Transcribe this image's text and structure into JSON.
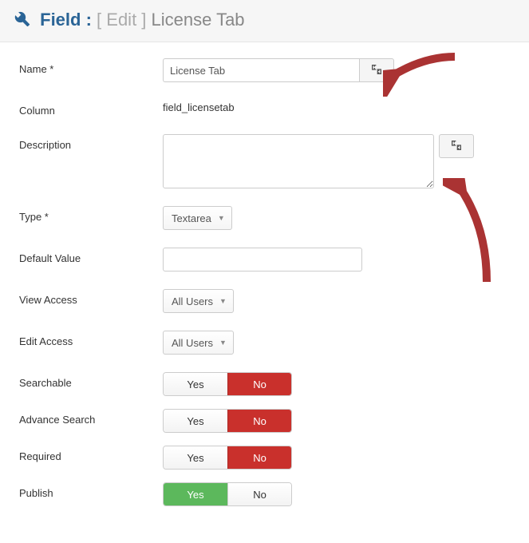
{
  "header": {
    "field_label": "Field",
    "colon": ":",
    "edit_label": "[ Edit ]",
    "item_title": "License Tab"
  },
  "form": {
    "name": {
      "label": "Name *",
      "value": "License Tab"
    },
    "column": {
      "label": "Column",
      "value": "field_licensetab"
    },
    "description": {
      "label": "Description",
      "value": ""
    },
    "type": {
      "label": "Type *",
      "selected": "Textarea"
    },
    "default_value": {
      "label": "Default Value",
      "value": ""
    },
    "view_access": {
      "label": "View Access",
      "selected": "All Users"
    },
    "edit_access": {
      "label": "Edit Access",
      "selected": "All Users"
    },
    "searchable": {
      "label": "Searchable",
      "yes": "Yes",
      "no": "No",
      "value": "No"
    },
    "advance_search": {
      "label": "Advance Search",
      "yes": "Yes",
      "no": "No",
      "value": "No"
    },
    "required": {
      "label": "Required",
      "yes": "Yes",
      "no": "No",
      "value": "No"
    },
    "publish": {
      "label": "Publish",
      "yes": "Yes",
      "no": "No",
      "value": "Yes"
    }
  }
}
